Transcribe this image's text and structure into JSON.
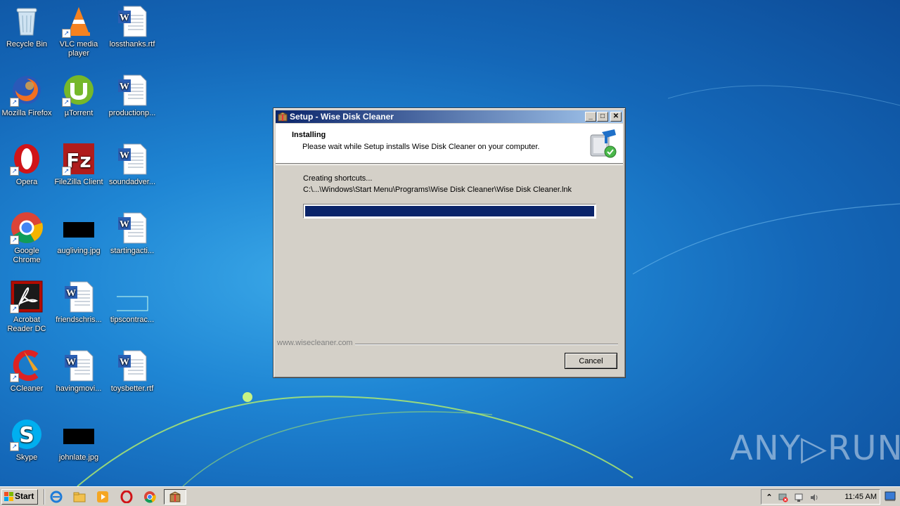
{
  "desktop": {
    "icons": [
      {
        "label": "Recycle Bin",
        "icon": "recycle-bin-icon"
      },
      {
        "label": "VLC media player",
        "icon": "vlc-icon"
      },
      {
        "label": "lossthanks.rtf",
        "icon": "word-doc-icon"
      },
      {
        "label": "Mozilla Firefox",
        "icon": "firefox-icon"
      },
      {
        "label": "µTorrent",
        "icon": "utorrent-icon"
      },
      {
        "label": "productionp...",
        "icon": "word-doc-icon"
      },
      {
        "label": "Opera",
        "icon": "opera-icon"
      },
      {
        "label": "FileZilla Client",
        "icon": "filezilla-icon"
      },
      {
        "label": "soundadver...",
        "icon": "word-doc-icon"
      },
      {
        "label": "Google Chrome",
        "icon": "chrome-icon"
      },
      {
        "label": "augliving.jpg",
        "icon": "image-file-icon"
      },
      {
        "label": "startingacti...",
        "icon": "word-doc-icon"
      },
      {
        "label": "Acrobat Reader DC",
        "icon": "acrobat-icon"
      },
      {
        "label": "friendschris...",
        "icon": "word-doc-icon"
      },
      {
        "label": "tipscontrac...",
        "icon": "blank-file-icon"
      },
      {
        "label": "CCleaner",
        "icon": "ccleaner-icon"
      },
      {
        "label": "havingmovi...",
        "icon": "word-doc-icon"
      },
      {
        "label": "toysbetter.rtf",
        "icon": "word-doc-icon"
      },
      {
        "label": "Skype",
        "icon": "skype-icon"
      },
      {
        "label": "johnlate.jpg",
        "icon": "image-file-icon"
      }
    ]
  },
  "dialog": {
    "title": "Setup - Wise Disk Cleaner",
    "heading": "Installing",
    "subheading": "Please wait while Setup installs Wise Disk Cleaner on your computer.",
    "status": "Creating shortcuts...",
    "path": "C:\\...\\Windows\\Start Menu\\Programs\\Wise Disk Cleaner\\Wise Disk Cleaner.lnk",
    "progress_percent": 100,
    "footer_link": "www.wisecleaner.com",
    "cancel_label": "Cancel",
    "minimize_glyph": "_",
    "maximize_glyph": "□",
    "close_glyph": "✕"
  },
  "watermark": "ANY▷RUN",
  "taskbar": {
    "start_label": "Start",
    "clock": "11:45 AM",
    "colors": {
      "face": "#d4d0c8",
      "title_active": "#0a246a"
    }
  }
}
